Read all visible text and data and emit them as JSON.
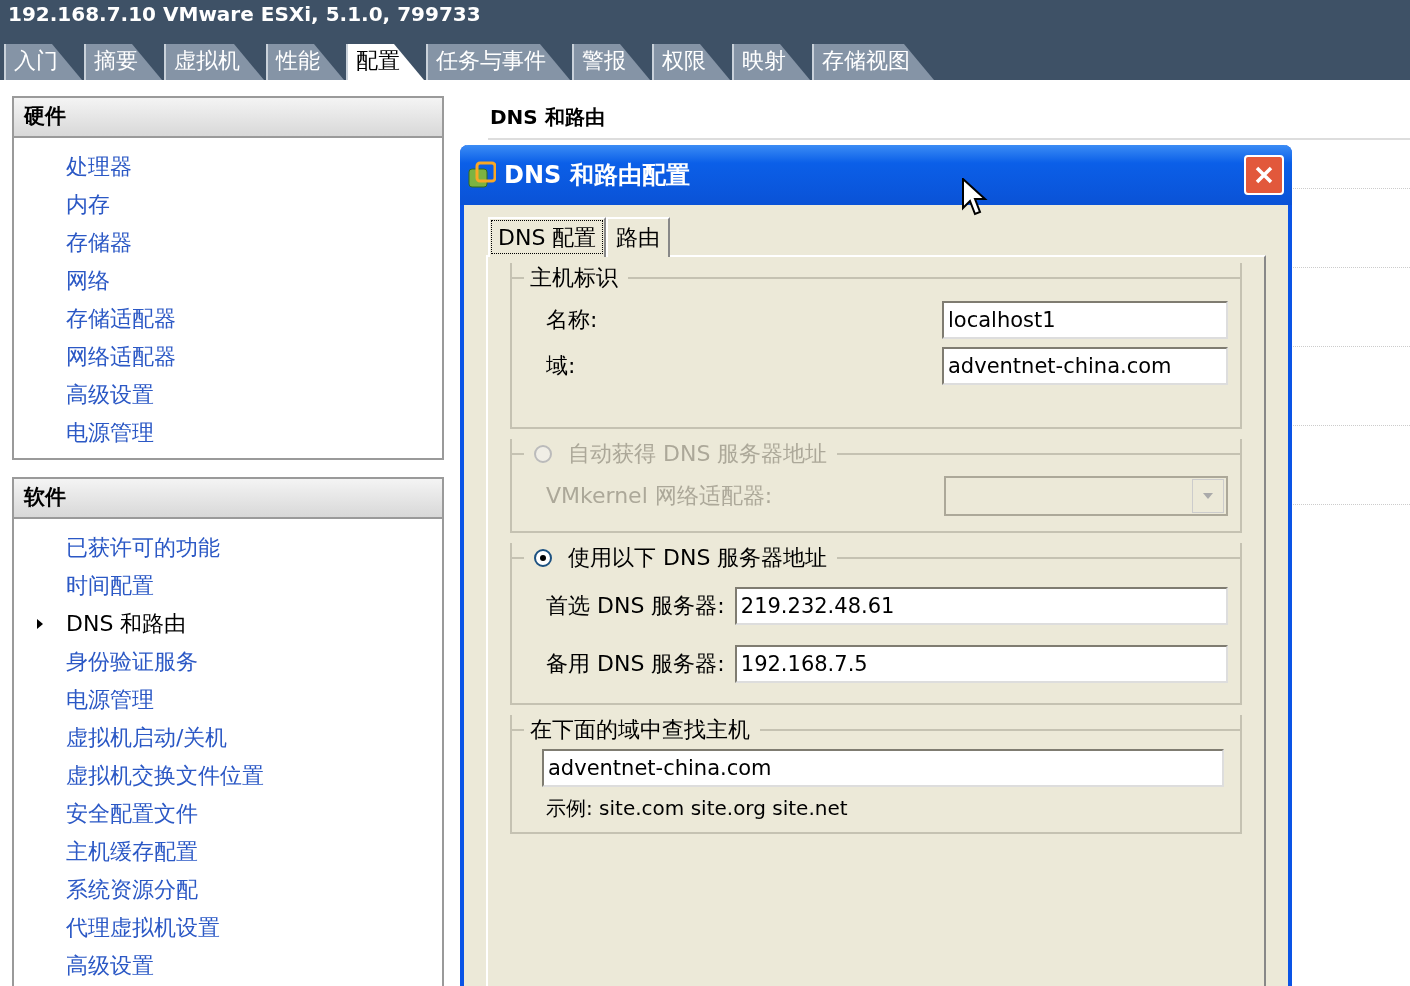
{
  "window": {
    "title": "192.168.7.10 VMware ESXi, 5.1.0, 799733"
  },
  "tabs": [
    {
      "label": "入门",
      "selected": false
    },
    {
      "label": "摘要",
      "selected": false
    },
    {
      "label": "虚拟机",
      "selected": false
    },
    {
      "label": "性能",
      "selected": false
    },
    {
      "label": "配置",
      "selected": true
    },
    {
      "label": "任务与事件",
      "selected": false
    },
    {
      "label": "警报",
      "selected": false
    },
    {
      "label": "权限",
      "selected": false
    },
    {
      "label": "映射",
      "selected": false
    },
    {
      "label": "存储视图",
      "selected": false
    }
  ],
  "sidebar": [
    {
      "title": "硬件",
      "items": [
        {
          "label": "处理器",
          "selected": false
        },
        {
          "label": "内存",
          "selected": false
        },
        {
          "label": "存储器",
          "selected": false
        },
        {
          "label": "网络",
          "selected": false
        },
        {
          "label": "存储适配器",
          "selected": false
        },
        {
          "label": "网络适配器",
          "selected": false
        },
        {
          "label": "高级设置",
          "selected": false
        },
        {
          "label": "电源管理",
          "selected": false
        }
      ]
    },
    {
      "title": "软件",
      "items": [
        {
          "label": "已获许可的功能",
          "selected": false
        },
        {
          "label": "时间配置",
          "selected": false
        },
        {
          "label": "DNS 和路由",
          "selected": true
        },
        {
          "label": "身份验证服务",
          "selected": false
        },
        {
          "label": "电源管理",
          "selected": false
        },
        {
          "label": "虚拟机启动/关机",
          "selected": false
        },
        {
          "label": "虚拟机交换文件位置",
          "selected": false
        },
        {
          "label": "安全配置文件",
          "selected": false
        },
        {
          "label": "主机缓存配置",
          "selected": false
        },
        {
          "label": "系统资源分配",
          "selected": false
        },
        {
          "label": "代理虚拟机设置",
          "selected": false
        },
        {
          "label": "高级设置",
          "selected": false
        }
      ]
    }
  ],
  "content": {
    "heading": "DNS 和路由"
  },
  "dialog": {
    "title": "DNS 和路由配置",
    "tabs": [
      {
        "label": "DNS 配置",
        "selected": true
      },
      {
        "label": "路由",
        "selected": false
      }
    ],
    "host_group": {
      "title": "主机标识",
      "fields": [
        {
          "label": "名称:",
          "value": "localhost1"
        },
        {
          "label": "域:",
          "value": "adventnet-china.com"
        }
      ]
    },
    "dns_options": [
      {
        "kind": "adapter",
        "label": "自动获得 DNS 服务器地址",
        "selected": false,
        "disabled": true,
        "fields": [
          {
            "label": "VMkernel 网络适配器:"
          }
        ]
      },
      {
        "kind": "servers",
        "label": "使用以下 DNS 服务器地址",
        "selected": true,
        "disabled": false,
        "fields": [
          {
            "label": "首选 DNS 服务器:",
            "value": "219.232.48.61"
          },
          {
            "label": "备用 DNS 服务器:",
            "value": "192.168.7.5"
          }
        ]
      }
    ],
    "search_group": {
      "title": "在下面的域中查找主机",
      "value": "adventnet-china.com",
      "example": "示例: site.com site.org site.net"
    }
  }
}
